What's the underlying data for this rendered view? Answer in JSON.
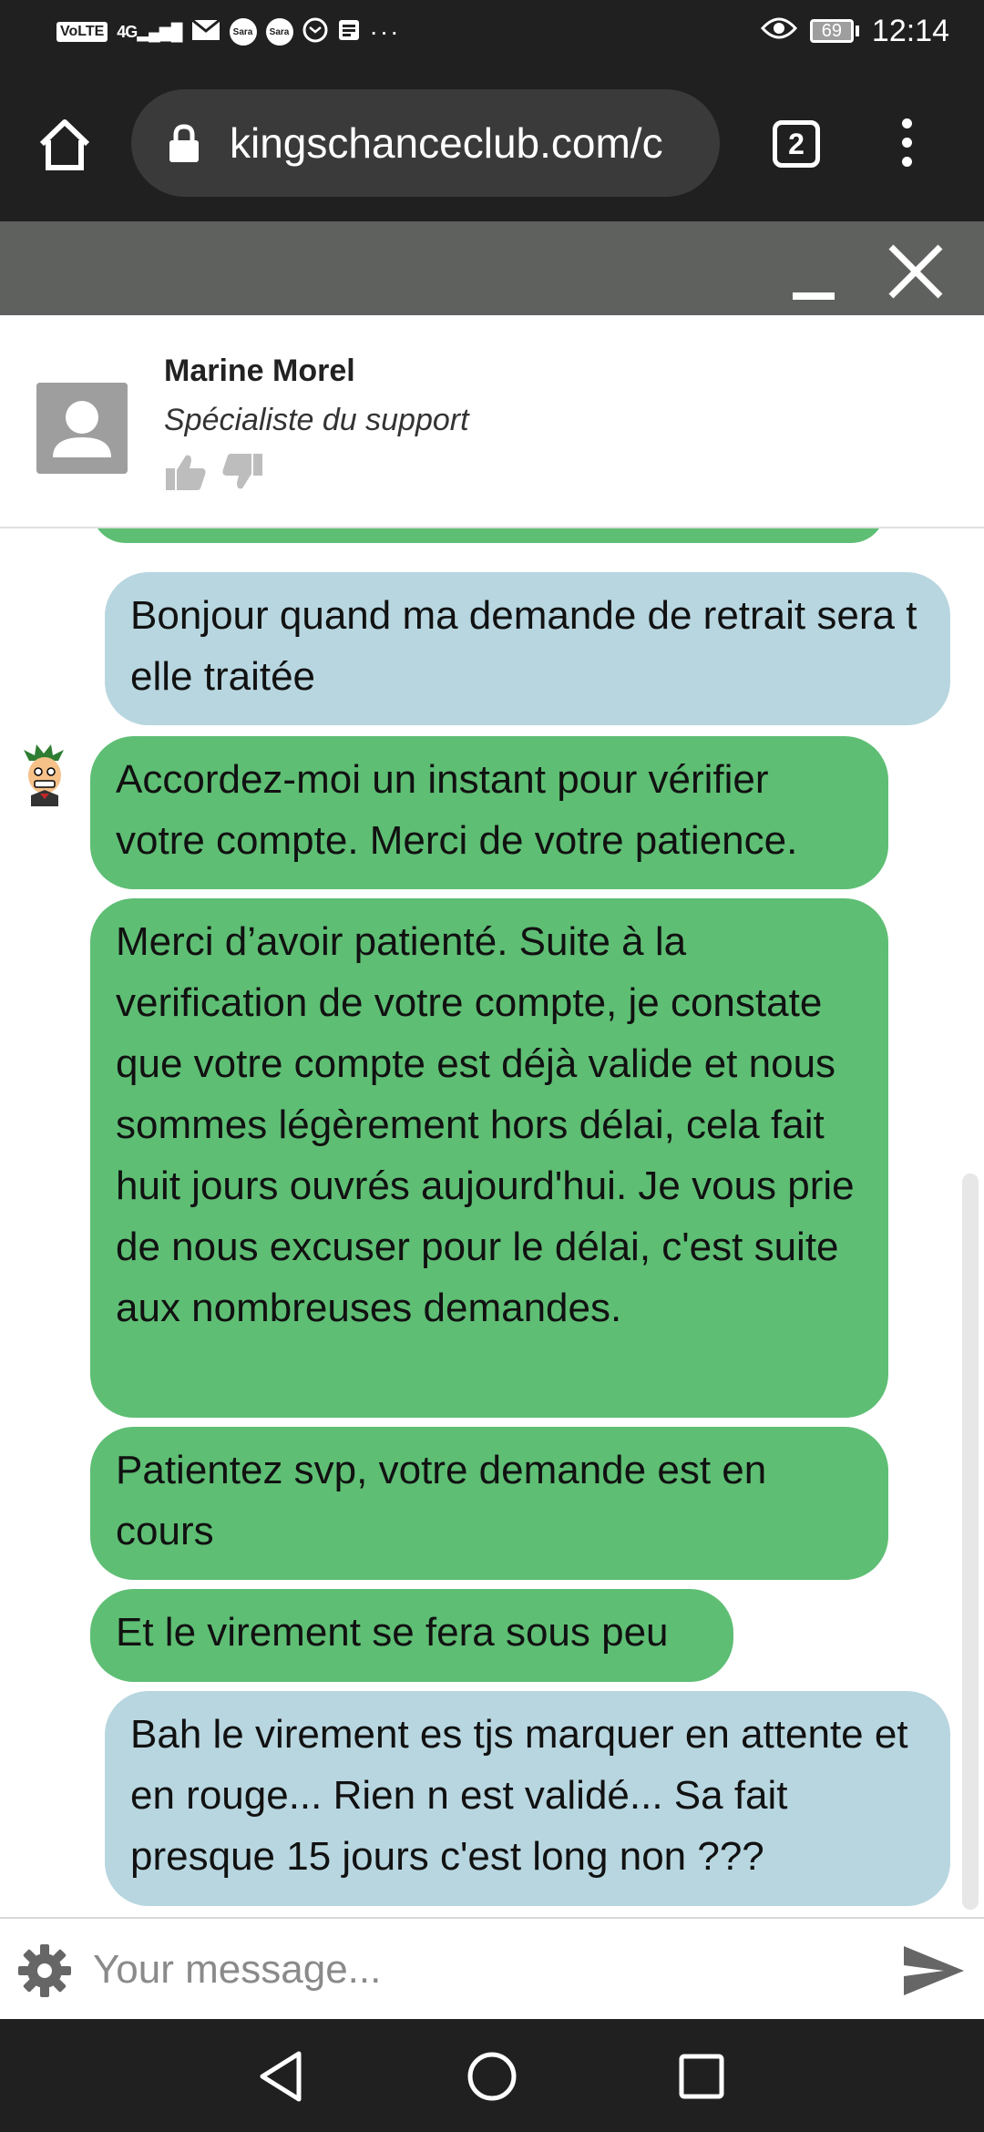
{
  "status_bar": {
    "left_icons": [
      "VoLTE",
      "4G",
      "mail-icon",
      "Sara",
      "Sara",
      "mail-icon",
      "news-icon",
      "..."
    ],
    "volte": "VoLTE",
    "network": "4G",
    "carrier_badge_1": "Sara",
    "carrier_badge_2": "Sara",
    "more": "···",
    "battery": "69",
    "time": "12:14"
  },
  "browser": {
    "url": "kingschanceclub.com/c",
    "tab_count": "2"
  },
  "agent": {
    "name": "Marine Morel",
    "role": "Spécialiste du support"
  },
  "messages": [
    {
      "sender": "user",
      "text": "Bonjour quand ma demande de retrait sera t elle traitée"
    },
    {
      "sender": "agent",
      "text": "Accordez-moi un instant pour vérifier votre compte. Merci de votre patience."
    },
    {
      "sender": "agent",
      "text": "Merci d’avoir patienté. Suite à la verification de votre compte, je constate que votre compte est déjà valide et nous sommes légèrement hors délai, cela fait huit jours ouvrés aujourd'hui. Je vous prie de nous excuser pour le délai, c'est suite aux nombreuses demandes."
    },
    {
      "sender": "agent",
      "text": "Patientez svp, votre demande est en cours"
    },
    {
      "sender": "agent",
      "text": "Et le virement se fera sous peu"
    },
    {
      "sender": "user",
      "text": "Bah le virement es tjs marquer en attente et en rouge... Rien n est validé... Sa fait presque 15 jours c'est long non ???"
    }
  ],
  "input": {
    "placeholder": "Your message..."
  },
  "colors": {
    "agent_bubble": "#5ebe74",
    "user_bubble": "#b7d6df",
    "browser_bg": "#202020",
    "widget_header": "#5f615e"
  }
}
